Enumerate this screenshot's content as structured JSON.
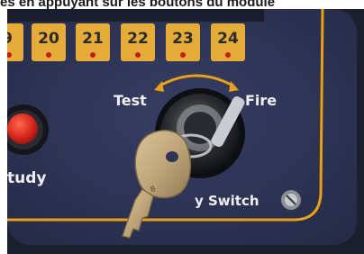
{
  "caption": "es en appuyant sur les boutons du module",
  "panel": {
    "channel_numbers": [
      "9",
      "20",
      "21",
      "22",
      "23",
      "24"
    ],
    "button_label_partial": "tudy",
    "switch_left_label": "Test",
    "switch_right_label": "Fire",
    "switch_caption": "y Switch"
  },
  "colors": {
    "panel": "#2d3456",
    "led_button": "#e6ac3a",
    "led": "#c8191b",
    "trim": "#e8a014",
    "red_button": "#d8281f",
    "key": "#c3a97e"
  }
}
